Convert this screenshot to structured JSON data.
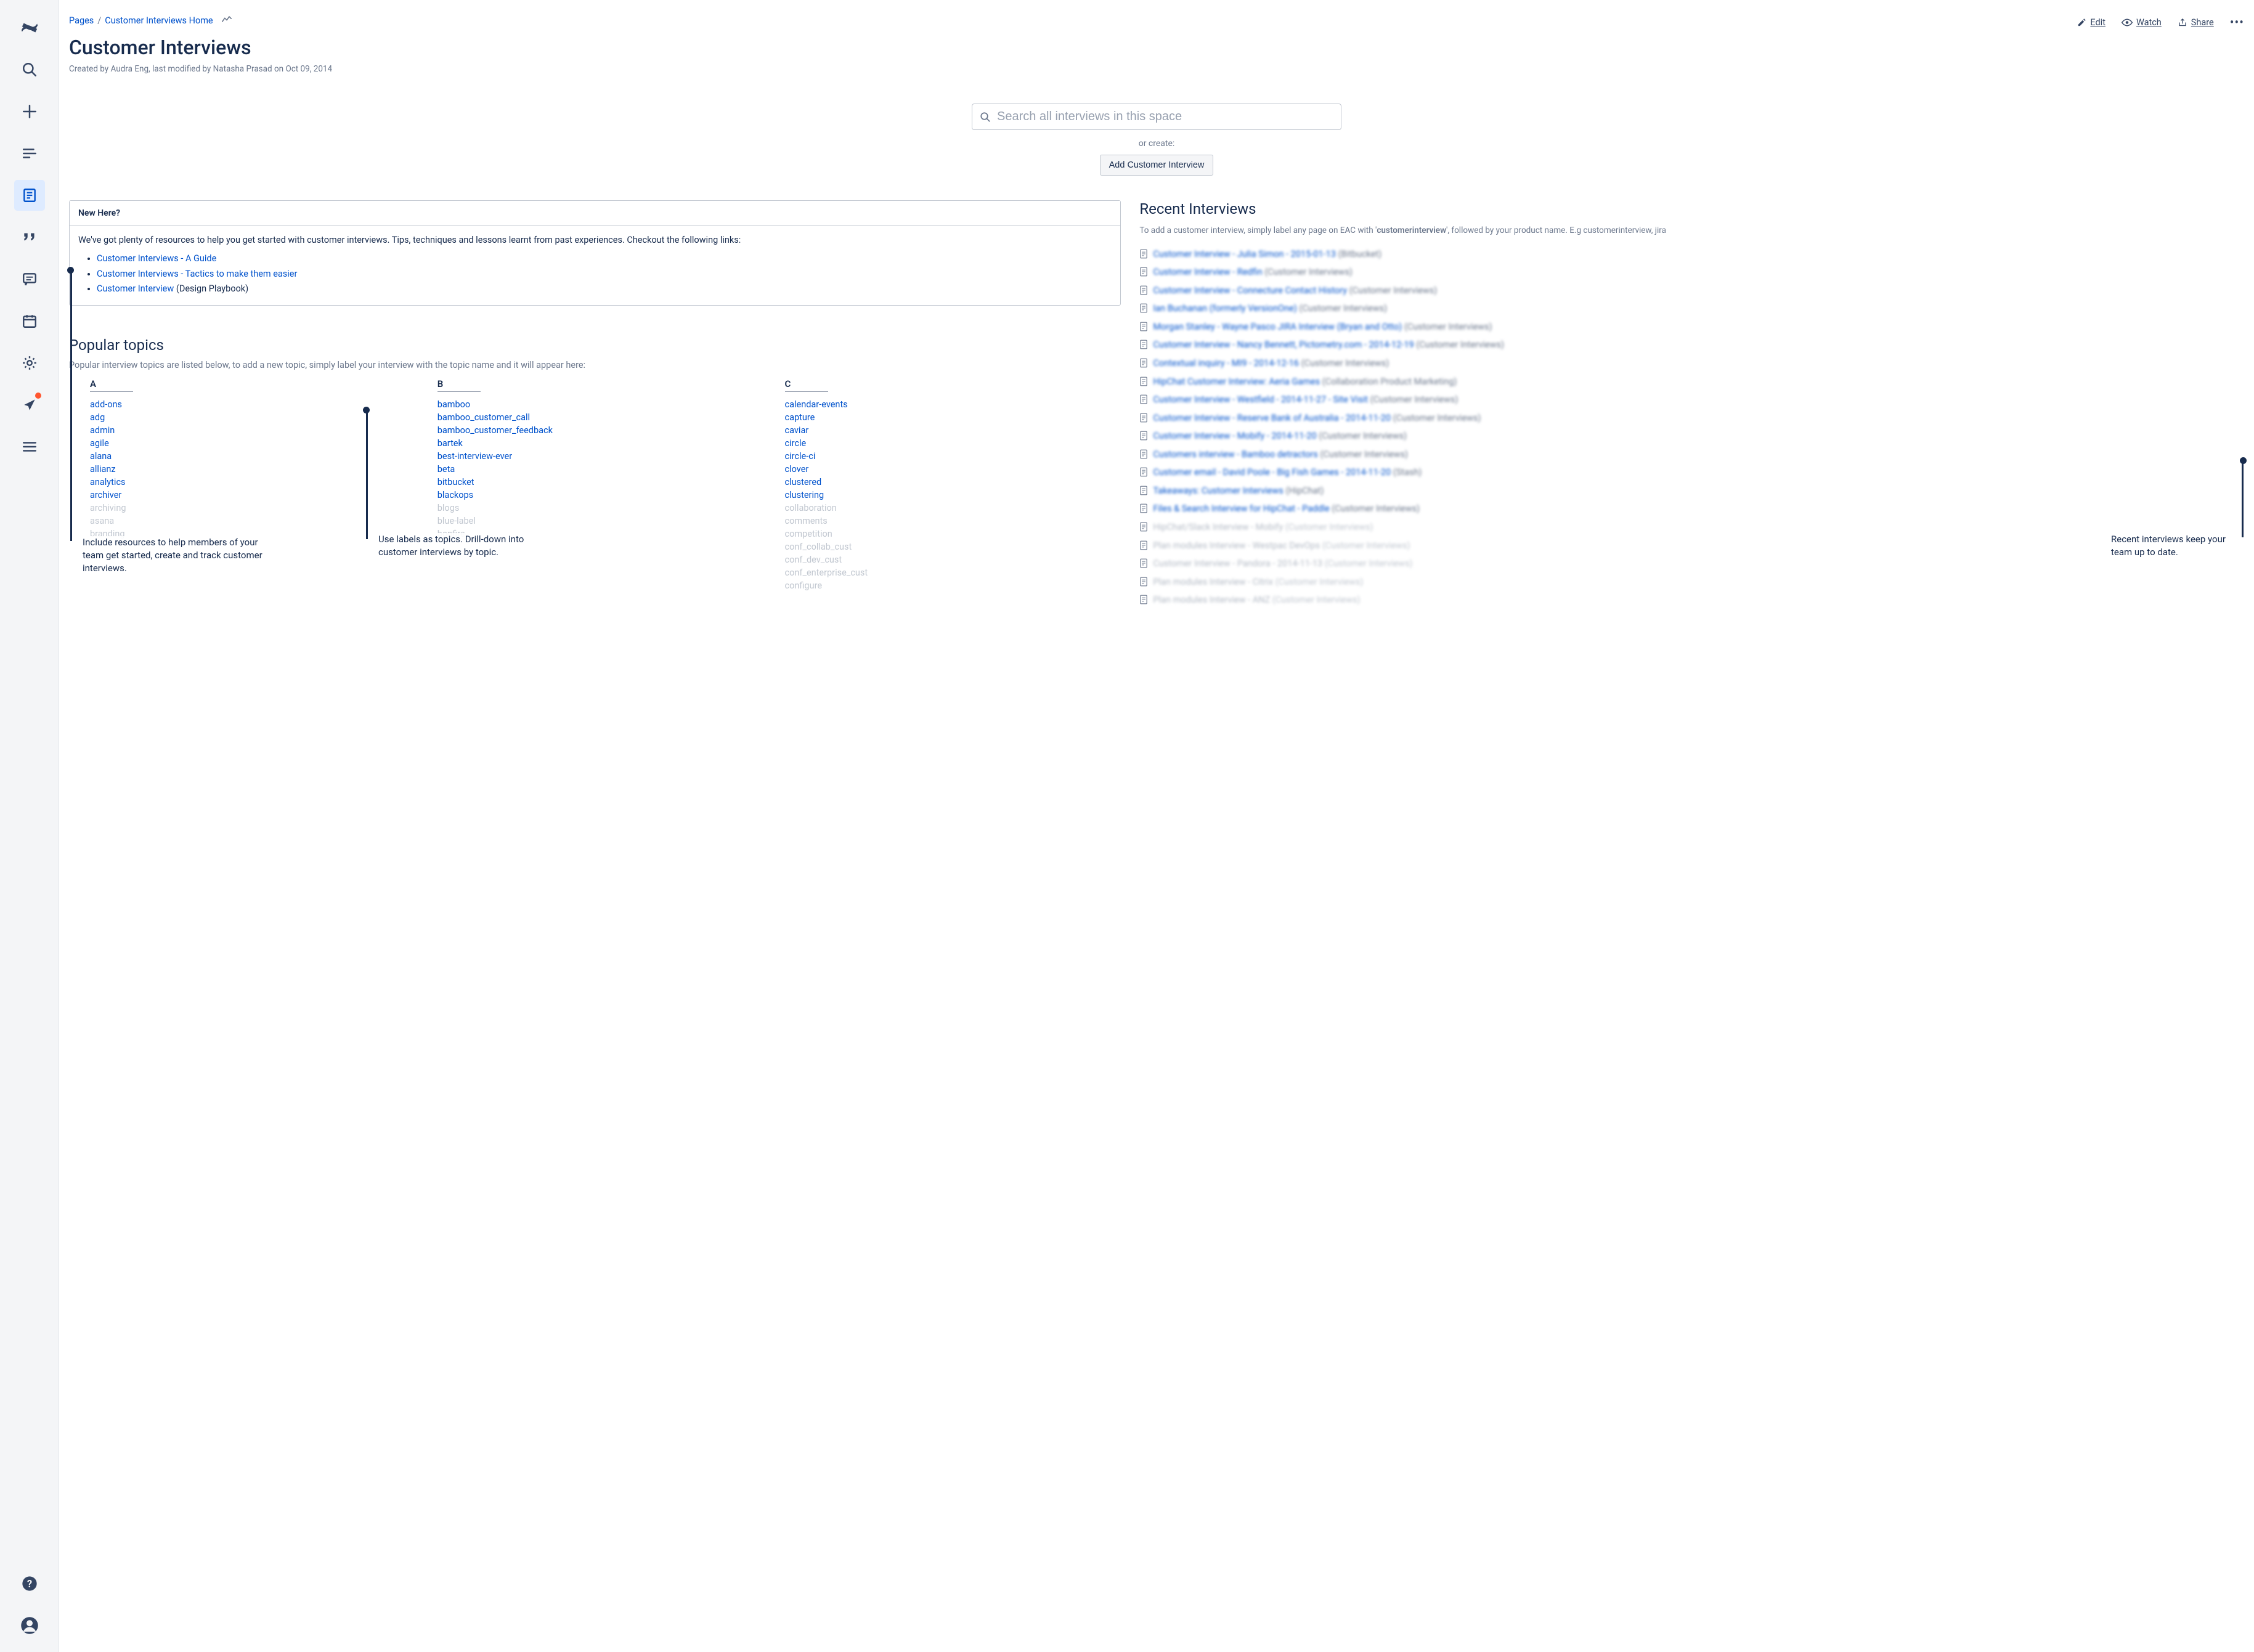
{
  "sidebar": {
    "items": [
      {
        "name": "confluence-logo"
      },
      {
        "name": "search-icon"
      },
      {
        "name": "create-icon"
      },
      {
        "name": "feed-icon"
      },
      {
        "name": "pages-icon"
      },
      {
        "name": "quote-icon"
      },
      {
        "name": "comments-icon"
      },
      {
        "name": "calendar-icon"
      },
      {
        "name": "settings-icon"
      },
      {
        "name": "notifications-icon"
      },
      {
        "name": "menu-icon"
      },
      {
        "name": "help-icon"
      },
      {
        "name": "profile-icon"
      }
    ]
  },
  "breadcrumb": {
    "root": "Pages",
    "parent": "Customer Interviews Home"
  },
  "actions": {
    "edit": "Edit",
    "watch": "Watch",
    "share": "Share"
  },
  "page": {
    "title": "Customer Interviews",
    "byline": "Created by Audra Eng, last modified by Natasha Prasad on Oct 09, 2014"
  },
  "search": {
    "placeholder": "Search all interviews in this space",
    "or_create": "or create:",
    "button": "Add Customer Interview"
  },
  "new_here": {
    "title": "New Here?",
    "intro": "We've got plenty of resources to help you get started with customer interviews. Tips, techniques and lessons learnt from past experiences. Checkout the following links:",
    "links": [
      {
        "label": "Customer Interviews - A Guide",
        "suffix": ""
      },
      {
        "label": "Customer Interviews - Tactics to make them easier",
        "suffix": ""
      },
      {
        "label": "Customer Interview",
        "suffix": " (Design Playbook)"
      }
    ]
  },
  "popular": {
    "title": "Popular topics",
    "sub": "Popular interview topics are listed below, to add a new topic, simply label your interview with the topic name and it will appear here:",
    "col_a_label": "A",
    "col_b_label": "B",
    "col_c_label": "C",
    "col_a": [
      {
        "t": "add-ons"
      },
      {
        "t": "adg"
      },
      {
        "t": "admin"
      },
      {
        "t": "agile"
      },
      {
        "t": "alana"
      },
      {
        "t": "allianz"
      },
      {
        "t": "analytics"
      },
      {
        "t": "archiver"
      },
      {
        "t": "archiving",
        "f": true
      },
      {
        "t": "asana",
        "f": true
      },
      {
        "t": "branding",
        "f": true
      }
    ],
    "col_b": [
      {
        "t": "bamboo"
      },
      {
        "t": "bamboo_customer_call"
      },
      {
        "t": "bamboo_customer_feedback"
      },
      {
        "t": "bartek"
      },
      {
        "t": "best-interview-ever"
      },
      {
        "t": "beta"
      },
      {
        "t": "bitbucket"
      },
      {
        "t": "blackops"
      },
      {
        "t": "blogs",
        "f": true
      },
      {
        "t": "blue-label",
        "f": true
      },
      {
        "t": "bonfire",
        "f": true
      }
    ],
    "col_c": [
      {
        "t": "calendar-events"
      },
      {
        "t": "capture"
      },
      {
        "t": "caviar"
      },
      {
        "t": "circle"
      },
      {
        "t": "circle-ci"
      },
      {
        "t": "clover"
      },
      {
        "t": "clustered"
      },
      {
        "t": "clustering"
      },
      {
        "t": "collaboration",
        "f": true
      },
      {
        "t": "comments",
        "f": true
      },
      {
        "t": "competition",
        "f": true
      },
      {
        "t": "conf_collab_cust",
        "f": true
      },
      {
        "t": "conf_dev_cust",
        "f": true
      },
      {
        "t": "conf_enterprise_cust",
        "f": true
      },
      {
        "t": "configure",
        "f": true
      }
    ]
  },
  "recent": {
    "title": "Recent Interviews",
    "sub_a": "To add a customer interview, simply label any page on EAC with '",
    "sub_b": "customerinterview",
    "sub_c": "', followed by your product name. E.g customerinterview, jira",
    "items": [
      {
        "link": "Customer Interview - Julia Simon - 2015-01-13",
        "meta": "(Bitbucket)"
      },
      {
        "link": "Customer Interview - Redfin",
        "meta": "(Customer Interviews)"
      },
      {
        "link": "Customer Interview - Connecture Contact History",
        "meta": "(Customer Interviews)"
      },
      {
        "link": "Ian Buchanan (formerly VersionOne)",
        "meta": "(Customer Interviews)"
      },
      {
        "link": "Morgan Stanley - Wayne Pasco JIRA Interview (Bryan and Otto)",
        "meta": "(Customer Interviews)"
      },
      {
        "link": "Customer Interview - Nancy Bennett, Pictometry.com - 2014-12-19",
        "meta": "(Customer Interviews)"
      },
      {
        "link": "Contextual inquiry - MI9 - 2014-12-16",
        "meta": "(Customer Interviews)"
      },
      {
        "link": "HipChat Customer Interview: Aeria Games",
        "meta": "(Collaboration Product Marketing)"
      },
      {
        "link": "Customer Interview - Westfield - 2014-11-27 - Site Visit",
        "meta": "(Customer Interviews)"
      },
      {
        "link": "Customer Interview - Reserve Bank of Australia - 2014-11-20",
        "meta": "(Customer Interviews)"
      },
      {
        "link": "Customer Interview - Mobify - 2014-11-20",
        "meta": "(Customer Interviews)"
      },
      {
        "link": "Customers interview - Bamboo detractors",
        "meta": "(Customer Interviews)"
      },
      {
        "link": "Customer email - David Poole - Big Fish Games - 2014-11-20",
        "meta": "(Stash)"
      },
      {
        "link": "Takeaways: Customer Interviews",
        "meta": "(HipChat)"
      },
      {
        "link": "Files & Search Interview for HipChat - Paddle",
        "meta": "(Customer Interviews)"
      },
      {
        "link": "HipChat/Slack Interview - Mobify",
        "meta": "(Customer Interviews)",
        "faded": true
      },
      {
        "link": "Plan modules Interview - Westpac DevOps",
        "meta": "(Customer Interviews)",
        "faded": true
      },
      {
        "link": "Customer Interview - Pandora - 2014-11-13",
        "meta": "(Customer Interviews)",
        "faded": true
      },
      {
        "link": "Plan modules Interview - Citrix",
        "meta": "(Customer Interviews)",
        "faded": true
      },
      {
        "link": "Plan modules Interview - ANZ",
        "meta": "(Customer Interviews)",
        "faded": true
      }
    ]
  },
  "annotations": {
    "left": "Include resources to help members of your team get started, create and track customer interviews.",
    "mid": "Use labels as topics. Drill-down into customer interviews by topic.",
    "right": "Recent interviews keep your team up to date."
  }
}
